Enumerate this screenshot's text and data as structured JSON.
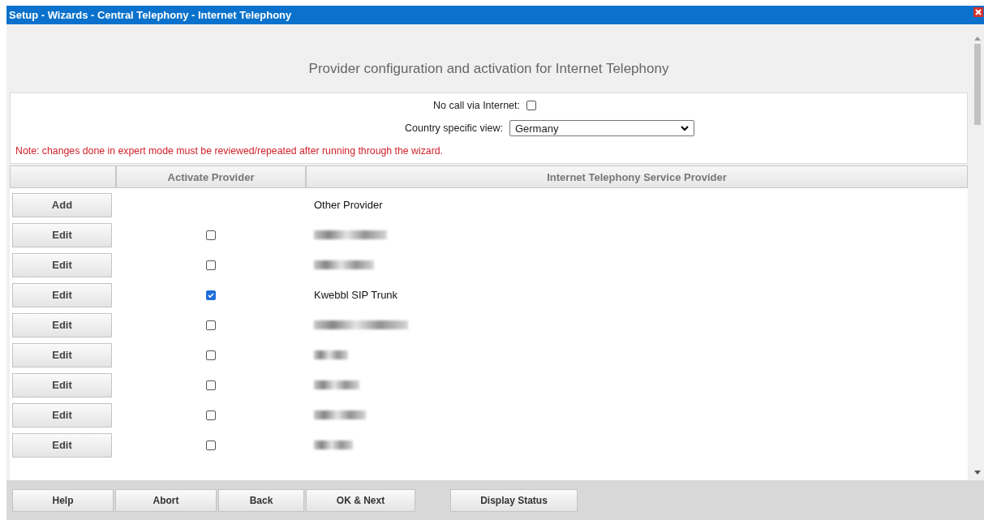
{
  "window": {
    "title": "Setup - Wizards - Central Telephony - Internet Telephony"
  },
  "heading": "Provider configuration and activation for Internet Telephony",
  "settings": {
    "no_call_label": "No call via Internet:",
    "no_call_checked": false,
    "country_label": "Country specific view:",
    "country_value": "Germany",
    "note": "Note: changes done in expert mode must be reviewed/repeated after running through the wizard."
  },
  "table": {
    "columns": [
      "Activate Provider",
      "Internet Telephony Service Provider"
    ],
    "rows": [
      {
        "kind": "add",
        "button": "Add",
        "name": "Other Provider"
      },
      {
        "kind": "provider",
        "button": "Edit",
        "checked": false,
        "redacted": true
      },
      {
        "kind": "provider",
        "button": "Edit",
        "checked": false,
        "redacted": true
      },
      {
        "kind": "provider",
        "button": "Edit",
        "checked": true,
        "name": "Kwebbl SIP Trunk"
      },
      {
        "kind": "provider",
        "button": "Edit",
        "checked": false,
        "redacted": true
      },
      {
        "kind": "provider",
        "button": "Edit",
        "checked": false,
        "redacted": true
      },
      {
        "kind": "provider",
        "button": "Edit",
        "checked": false,
        "redacted": true
      },
      {
        "kind": "provider",
        "button": "Edit",
        "checked": false,
        "redacted": true
      },
      {
        "kind": "provider",
        "button": "Edit",
        "checked": false,
        "redacted": true
      }
    ]
  },
  "footer_buttons": [
    "Help",
    "Abort",
    "Back",
    "OK & Next"
  ],
  "status_button": "Display Status"
}
